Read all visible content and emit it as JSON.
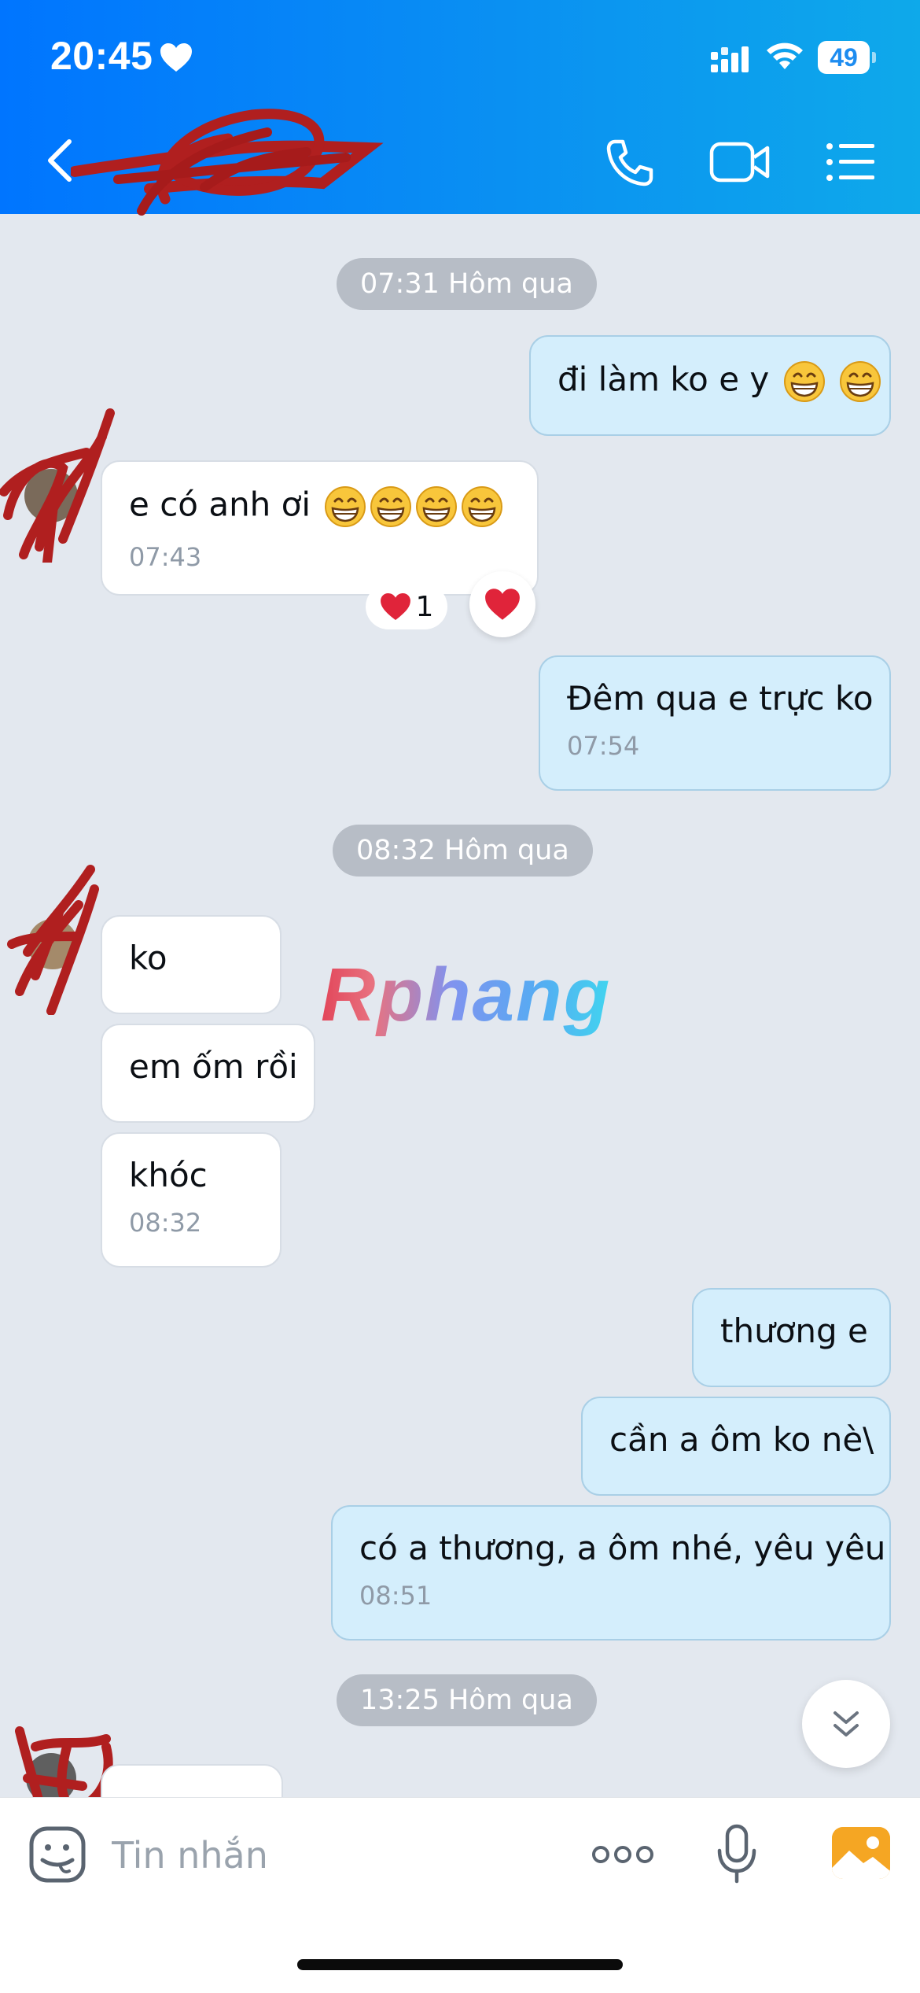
{
  "status_bar": {
    "time": "20:45",
    "battery": "49"
  },
  "header": {
    "contact_name": ""
  },
  "messages": {
    "date1": "07:31 Hôm qua",
    "m1_text": "đi làm ko e y",
    "m2_text": "e có anh ơi",
    "m2_time": "07:43",
    "m2_reaction_count": "1",
    "m3_text": "Đêm qua e trực ko",
    "m3_time": "07:54",
    "date2": "08:32 Hôm qua",
    "m4_text": "ko",
    "m5_text": "em ốm rồi",
    "m6_text": "khóc",
    "m6_time": "08:32",
    "m7_text": "thương e",
    "m8_text": "cần a ôm ko nè\\",
    "m9_text": "có a thương, a ôm nhé, yêu yêu",
    "m9_time": "08:51",
    "date3": "13:25 Hôm qua"
  },
  "watermark": "Rphang",
  "composer": {
    "placeholder": "Tin nhắn"
  },
  "colors": {
    "header_start": "#0075ff",
    "header_end": "#0ea9ea",
    "outgoing_bubble": "#d4eefc",
    "incoming_bubble": "#ffffff",
    "chat_bg": "#e3e8ef"
  }
}
